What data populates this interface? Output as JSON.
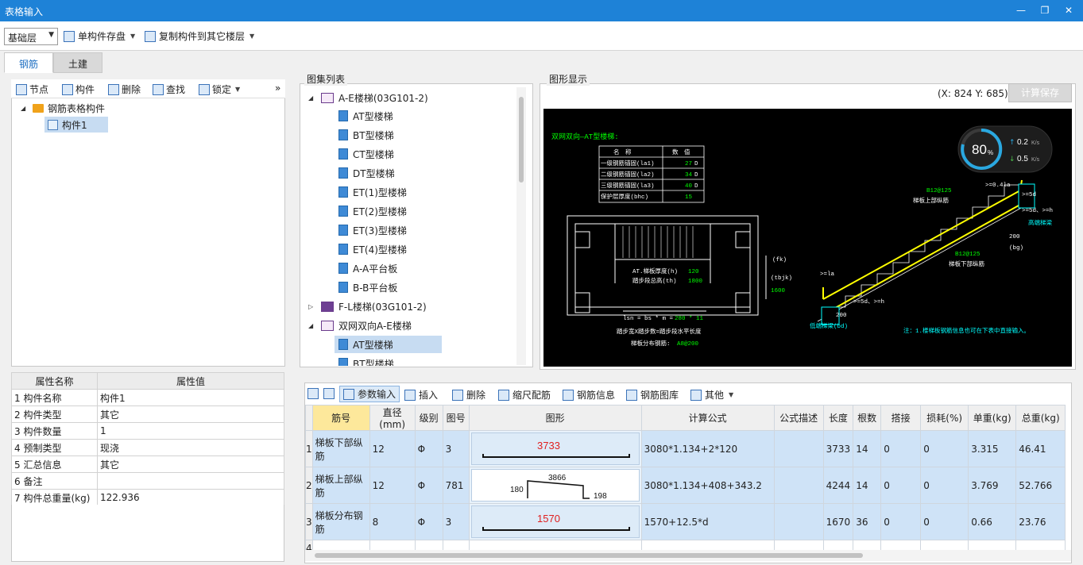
{
  "window": {
    "title": "表格输入"
  },
  "toolbar": {
    "floor_value": "基础层",
    "save_single": "单构件存盘",
    "copy_to_floor": "复制构件到其它楼层"
  },
  "tabs": [
    {
      "label": "钢筋"
    },
    {
      "label": "土建"
    }
  ],
  "left_toolbar": {
    "node": "节点",
    "component": "构件",
    "delete": "删除",
    "find": "查找",
    "lock": "锁定",
    "more": "»"
  },
  "tree": {
    "root": "钢筋表格构件",
    "child": "构件1"
  },
  "properties": {
    "headers": [
      "属性名称",
      "属性值"
    ],
    "rows": [
      {
        "n": "1",
        "name": "构件名称",
        "value": "构件1"
      },
      {
        "n": "2",
        "name": "构件类型",
        "value": "其它"
      },
      {
        "n": "3",
        "name": "构件数量",
        "value": "1"
      },
      {
        "n": "4",
        "name": "预制类型",
        "value": "现浇"
      },
      {
        "n": "5",
        "name": "汇总信息",
        "value": "其它"
      },
      {
        "n": "6",
        "name": "备注",
        "value": ""
      },
      {
        "n": "7",
        "name": "构件总重量(kg)",
        "value": "122.936"
      }
    ]
  },
  "atlas": {
    "label": "图集列表",
    "group1": "A-E楼梯(03G101-2)",
    "items1": [
      "AT型楼梯",
      "BT型楼梯",
      "CT型楼梯",
      "DT型楼梯",
      "ET(1)型楼梯",
      "ET(2)型楼梯",
      "ET(3)型楼梯",
      "ET(4)型楼梯",
      "A-A平台板",
      "B-B平台板"
    ],
    "group2": "F-L楼梯(03G101-2)",
    "group3": "双网双向A-E楼梯",
    "items3": [
      "AT型楼梯",
      "BT型楼梯"
    ]
  },
  "graphic": {
    "label": "图形显示",
    "coord": "(X: 824 Y: 685)",
    "calc_save": "计算保存",
    "drawing_title": "双网双向—AT型楼梯:",
    "spec_headers": [
      "名　称",
      "数　值"
    ],
    "spec_rows": [
      {
        "name": "一级钢筋锚固(la1)",
        "value": "27",
        "unit": "D"
      },
      {
        "name": "二级钢筋锚固(la2)",
        "value": "34",
        "unit": "D"
      },
      {
        "name": "三级钢筋锚固(la3)",
        "value": "40",
        "unit": "D"
      },
      {
        "name": "保护层厚度(bhc)",
        "value": "15",
        "unit": ""
      }
    ],
    "plan_text1": "AT.梯板厚度(h)",
    "plan_val1": "120",
    "plan_text2": "踏步段总高(th)",
    "plan_val2": "1800",
    "fk": "(fk)",
    "tbjk": "(tbjk)",
    "tbjk_val": "1600",
    "lsn_text": "lsn = bs * m =",
    "lsn_val": "280 * 11",
    "step_text": "踏步宽X踏步数=踏步段水平长度",
    "dist_text": "梯板分布钢筋:",
    "dist_val": "A8@200",
    "top_bar": "B12@125",
    "top_bar_label": "梯板上部纵筋",
    "bot_bar": "B12@125",
    "bot_bar_label": "梯板下部纵筋",
    "high_beam": "高端梯梁",
    "low_beam": "低端梯梁(bd)",
    "dim_200a": "200",
    "dim_bg": "(bg)",
    "dim_200b": "200",
    "la_left": ">=la",
    "la_top": ">=0.4la",
    "five_d_h": ">=5d、>=h",
    "five_d_h2": ">=5d、>=h",
    "five_d": ">=5d",
    "note": "注：1.楼梯板钢筋信息也可在下表中直接输入。",
    "gauge_pct": "80",
    "gauge_unit": "%",
    "up_speed": "0.2",
    "down_speed": "0.5",
    "speed_unit": "K/s"
  },
  "grid_toolbar": {
    "param_input": "参数输入",
    "insert": "插入",
    "delete": "删除",
    "scale": "缩尺配筋",
    "rebar_info": "钢筋信息",
    "rebar_lib": "钢筋图库",
    "other": "其他"
  },
  "grid": {
    "headers": [
      "筋号",
      "直径(mm)",
      "级别",
      "图号",
      "图形",
      "计算公式",
      "公式描述",
      "长度",
      "根数",
      "搭接",
      "损耗(%)",
      "单重(kg)",
      "总重(kg)"
    ],
    "rows": [
      {
        "n": "1",
        "name": "梯板下部纵筋",
        "dia": "12",
        "grade": "Φ",
        "fig": "3",
        "shape_label": "3733",
        "formula": "3080*1.134+2*120",
        "desc": "",
        "len": "3733",
        "count": "14",
        "lap": "0",
        "loss": "0",
        "unit_w": "3.315",
        "total_w": "46.41"
      },
      {
        "n": "2",
        "name": "梯板上部纵筋",
        "dia": "12",
        "grade": "Φ",
        "fig": "781",
        "shape_label": "3866",
        "shape_left": "180",
        "shape_right": "198",
        "formula": "3080*1.134+408+343.2",
        "desc": "",
        "len": "4244",
        "count": "14",
        "lap": "0",
        "loss": "0",
        "unit_w": "3.769",
        "total_w": "52.766"
      },
      {
        "n": "3",
        "name": "梯板分布钢筋",
        "dia": "8",
        "grade": "Φ",
        "fig": "3",
        "shape_label": "1570",
        "formula": "1570+12.5*d",
        "desc": "",
        "len": "1670",
        "count": "36",
        "lap": "0",
        "loss": "0",
        "unit_w": "0.66",
        "total_w": "23.76"
      }
    ],
    "empty_row": "4"
  },
  "colors": {
    "titlebar": "#1e82d7",
    "selection": "#cfe3f7",
    "key_header": "#fde89b",
    "cad_green": "#00ff00",
    "cad_yellow": "#ffff00",
    "cad_cyan": "#00ffff"
  }
}
